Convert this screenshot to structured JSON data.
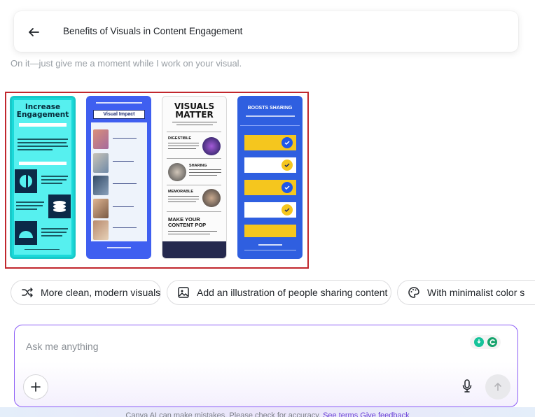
{
  "header": {
    "title": "Benefits of Visuals in Content Engagement",
    "back_icon": "arrow-left-icon"
  },
  "status": "On it—just give me a moment while I work on your visual.",
  "thumbnails": [
    {
      "title": "Increase Engagement",
      "colors": {
        "bg": "#56f0ef",
        "dark": "#0b2a48",
        "border": "#19c9c9"
      }
    },
    {
      "title": "Visual Impact",
      "colors": {
        "bg": "#3f5ff0",
        "panel": "#eef3fb"
      }
    },
    {
      "title": "VISUALS MATTER",
      "sections": [
        "DIGESTIBLE",
        "SHARING",
        "MEMORABLE"
      ],
      "cta": "MAKE YOUR CONTENT POP",
      "colors": {
        "bg": "#fbfbfb",
        "footer": "#25294e"
      }
    },
    {
      "title": "BOOSTS SHARING",
      "colors": {
        "bg": "#2f5fe0",
        "row": "#f5c61e",
        "check": "#1f57e8"
      }
    }
  ],
  "suggestions": [
    {
      "label": "More clean, modern visuals",
      "icon": "shuffle-icon"
    },
    {
      "label": "Add an illustration of people sharing content",
      "icon": "image-icon"
    },
    {
      "label": "With minimalist color s",
      "icon": "palette-icon"
    }
  ],
  "prompt": {
    "placeholder": "Ask me anything",
    "value": ""
  },
  "disclaimer": {
    "text": "Canva AI can make mistakes. Please check for accuracy.",
    "link1": "See terms",
    "link2": "Give feedback"
  },
  "accent_colors": {
    "selection": "#c1272d",
    "prompt_border": "#8b5cf6",
    "link": "#6a3fd6"
  }
}
